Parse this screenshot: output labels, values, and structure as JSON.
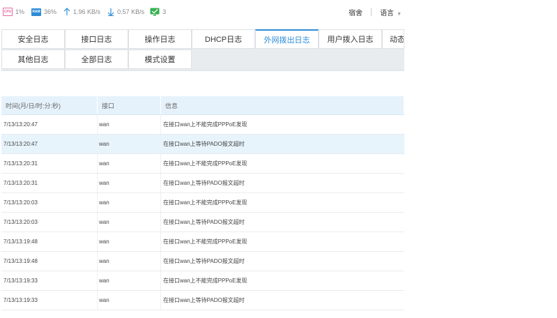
{
  "status": {
    "cpu_icon_label": "CPU",
    "cpu": "1%",
    "ram_icon_label": "RAM",
    "ram": "36%",
    "upload": "1.96 KB/s",
    "download": "0.57 KB/s",
    "connections": "3",
    "colors": {
      "cpu": "#e56a9e",
      "ram": "#2c8cd7",
      "arrow": "#2c8cd7",
      "conn": "#35b050"
    }
  },
  "header": {
    "user_label": "宿舍",
    "language_label": "语言"
  },
  "tabs": [
    {
      "label": "安全日志"
    },
    {
      "label": "接口日志"
    },
    {
      "label": "操作日志"
    },
    {
      "label": "DHCP日志"
    },
    {
      "label": "外网拨出日志",
      "active": true
    },
    {
      "label": "用户拨入日志"
    },
    {
      "label": "动态"
    },
    {
      "label": "其他日志"
    },
    {
      "label": "全部日志"
    },
    {
      "label": "模式设置"
    }
  ],
  "table": {
    "headers": [
      "时间(月/日/时:分:秒)",
      "接口",
      "信息"
    ],
    "rows": [
      {
        "time": "7/13/13:20:47",
        "iface": "wan",
        "info": "在接口wan上不能完成PPPoE发现"
      },
      {
        "time": "7/13/13:20:47",
        "iface": "wan",
        "info": "在接口wan上等待PADO报文超时"
      },
      {
        "time": "7/13/13:20:31",
        "iface": "wan",
        "info": "在接口wan上不能完成PPPoE发现"
      },
      {
        "time": "7/13/13:20:31",
        "iface": "wan",
        "info": "在接口wan上等待PADO报文超时"
      },
      {
        "time": "7/13/13:20:03",
        "iface": "wan",
        "info": "在接口wan上不能完成PPPoE发现"
      },
      {
        "time": "7/13/13:20:03",
        "iface": "wan",
        "info": "在接口wan上等待PADO报文超时"
      },
      {
        "time": "7/13/13:19:48",
        "iface": "wan",
        "info": "在接口wan上不能完成PPPoE发现"
      },
      {
        "time": "7/13/13:19:48",
        "iface": "wan",
        "info": "在接口wan上等待PADO报文超时"
      },
      {
        "time": "7/13/13:19:33",
        "iface": "wan",
        "info": "在接口wan上不能完成PPPoE发现"
      },
      {
        "time": "7/13/13:19:33",
        "iface": "wan",
        "info": "在接口wan上等待PADO报文超时"
      }
    ],
    "highlight_row": 1
  }
}
